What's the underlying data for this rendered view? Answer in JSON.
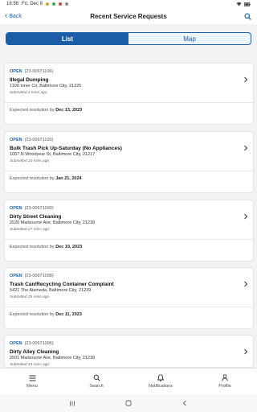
{
  "status_bar": {
    "time": "16:56",
    "date": "Fri, Dec 8",
    "battery": ""
  },
  "header": {
    "back_label": "Back",
    "title": "Recent Service Requests"
  },
  "tabs": [
    {
      "label": "List",
      "active": true
    },
    {
      "label": "Map",
      "active": false
    }
  ],
  "requests": [
    {
      "status": "OPEN",
      "id": "(23-00971106)",
      "type": "Illegal Dumping",
      "address": "1100 Inner Cir, Baltimore City, 21225",
      "submitted": "Submitted 4 mins ago",
      "resolution_prefix": "Expected resolution by",
      "resolution_date": "Dec 13, 2023"
    },
    {
      "status": "OPEN",
      "id": "(23-00971100)",
      "type": "Bulk Trash Pick Up-Saturday (No Appliances)",
      "address": "1007 N Woodyear St, Baltimore City, 21217",
      "submitted": "Submitted 20 mins ago",
      "resolution_prefix": "Expected resolution by",
      "resolution_date": "Jan 21, 2024"
    },
    {
      "status": "OPEN",
      "id": "(23-00971099)",
      "type": "Dirty Street Cleaning",
      "address": "2520 Marbourne Ave, Baltimore City, 21230",
      "submitted": "Submitted 27 mins ago",
      "resolution_prefix": "Expected resolution by",
      "resolution_date": "Dec 19, 2023"
    },
    {
      "status": "OPEN",
      "id": "(23-00971098)",
      "type": "Trash Can/Recycling Container Complaint",
      "address": "5421 The Alameda, Baltimore City, 21239",
      "submitted": "Submitted 25 mins ago",
      "resolution_prefix": "Expected resolution by",
      "resolution_date": "Dec 11, 2023"
    },
    {
      "status": "OPEN",
      "id": "(23-00971096)",
      "type": "Dirty Alley Cleaning",
      "address": "2501 Marbourne Ave, Baltimore City, 21230",
      "submitted": "Submitted 44 mins ago",
      "resolution_prefix": "",
      "resolution_date": ""
    }
  ],
  "bottom_nav": [
    {
      "label": "Menu",
      "icon": "menu-icon"
    },
    {
      "label": "Search",
      "icon": "search-icon"
    },
    {
      "label": "Notifications",
      "icon": "bell-icon"
    },
    {
      "label": "Profile",
      "icon": "person-icon"
    }
  ],
  "colors": {
    "accent": "#1a5ea8",
    "background": "#f2f2f4"
  }
}
